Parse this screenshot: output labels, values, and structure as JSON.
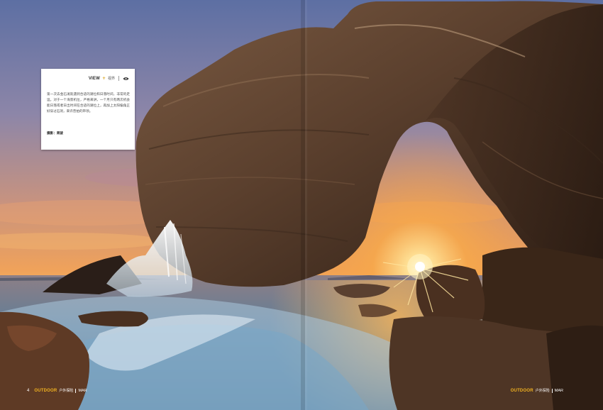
{
  "caption": {
    "view_word": "VIEW",
    "view_plus": "+",
    "view_cn": "视界",
    "body": "第一次去金石滩就遇到合适的潮位和日落时间，非常的走运。对于一个海景机位，严格来讲，一个月只有两次机会能日落或者日出时间在合适的潮位上，再加上太阳偏角正好穿过石洞，来许曾拍的带领。",
    "credit": "摄影：周骏"
  },
  "footer_left": {
    "page_number": "4",
    "brand": "OUTDOOR",
    "brand_cn": "户外探险",
    "month": "MAR"
  },
  "footer_right": {
    "brand": "OUTDOOR",
    "brand_cn": "户外探险",
    "month": "MAR"
  },
  "colors": {
    "accent": "#f2b320",
    "card_bg": "#ffffff",
    "sun": "#fff3c0"
  },
  "icons": {
    "view": "eye-icon"
  }
}
